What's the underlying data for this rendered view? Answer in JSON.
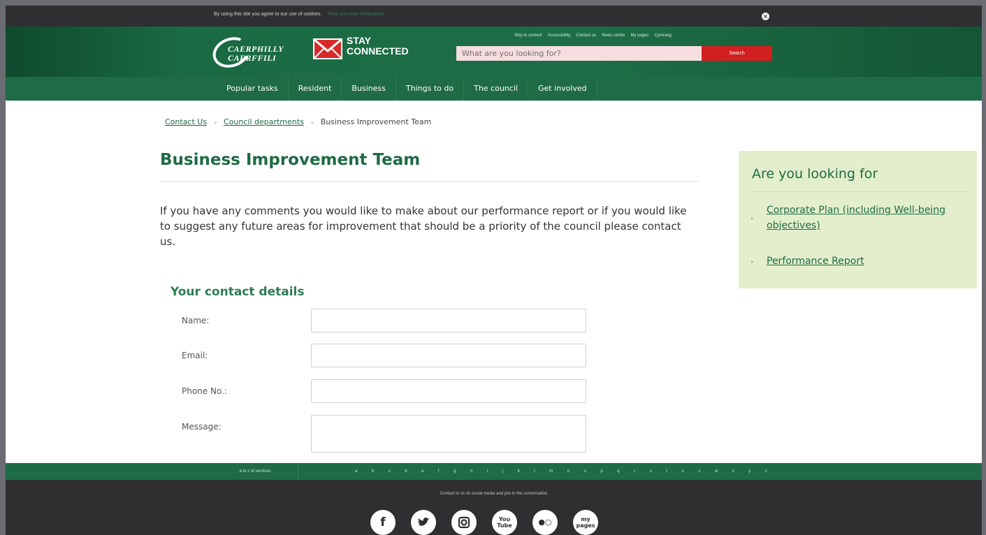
{
  "cookie_bar": {
    "text": "By using this site you agree to our use of cookies.",
    "link": "Find out more information",
    "close": "×"
  },
  "header": {
    "logo_line1": "CAERPHILLY",
    "logo_line2": "CAERFFILI",
    "stay_line1": "STAY",
    "stay_line2": "CONNECTED",
    "top_links": [
      "Skip to content",
      "Accessibility",
      "Contact us",
      "News centre",
      "My pages",
      "Cymraeg"
    ],
    "search_placeholder": "What are you looking for?",
    "search_button": "Search"
  },
  "nav": {
    "items": [
      "Popular tasks",
      "Resident",
      "Business",
      "Things to do",
      "The council",
      "Get involved"
    ]
  },
  "breadcrumb": {
    "items": [
      "Contact Us",
      "Council departments"
    ],
    "current": "Business Improvement Team",
    "separator": "»"
  },
  "main": {
    "title": "Business Improvement Team",
    "intro": "If you have any comments you would like to make about our performance report or if you would like to suggest any future areas for improvement that should be a priority of the council please contact us.",
    "form": {
      "heading": "Your contact details",
      "name_label": "Name:",
      "email_label": "Email:",
      "phone_label": "Phone No.:",
      "message_label": "Message:"
    }
  },
  "sidebar": {
    "title": "Are you looking for",
    "links": [
      "Corporate Plan (including Well-being objectives)",
      "Performance Report"
    ],
    "bullet": "▸"
  },
  "az": {
    "label": "a to z of services",
    "letters": [
      "a",
      "b",
      "c",
      "d",
      "e",
      "f",
      "g",
      "h",
      "i",
      "j",
      "k",
      "l",
      "m",
      "n",
      "o",
      "p",
      "q",
      "r",
      "s",
      "t",
      "u",
      "v",
      "w",
      "x",
      "y",
      "z"
    ]
  },
  "footer": {
    "text": "Contact to us on social media and join in the conversation",
    "social": {
      "facebook": "f",
      "twitter": "🐦",
      "instagram": "◙",
      "youtube_top": "You",
      "youtube_bottom": "Tube",
      "flickr": "●○",
      "mypages_top": "my",
      "mypages_bottom": "pages"
    }
  },
  "colors": {
    "brand_green": "#1f6a44",
    "nav_green": "#1e6b45",
    "search_red": "#d21f1f",
    "sidebar_bg": "#e3efcc",
    "footer_dark": "#2f2f31"
  }
}
